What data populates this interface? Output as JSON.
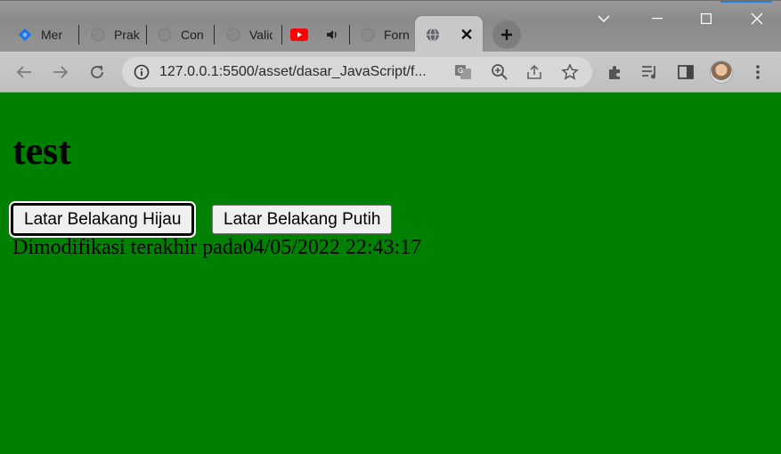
{
  "browser": {
    "tabs": [
      {
        "label": "Mer",
        "icon": "blue-diamond-icon"
      },
      {
        "label": "Prak",
        "icon": "globe-icon"
      },
      {
        "label": "Con",
        "icon": "globe-icon"
      },
      {
        "label": "Valid",
        "icon": "globe-icon"
      },
      {
        "label": "",
        "icon": "youtube-icon"
      },
      {
        "label": "Forn",
        "icon": "globe-icon"
      }
    ],
    "active_tab": {
      "icon": "globe-icon",
      "close": "✕"
    },
    "new_tab": "+",
    "url": "127.0.0.1:5500/asset/dasar_JavaScript/f..."
  },
  "page": {
    "heading": "test",
    "buttons": {
      "green": "Latar Belakang Hijau",
      "white": "Latar Belakang Putih"
    },
    "modified_label": "Dimodifikasi terakhir pada",
    "modified_value": "04/05/2022 22:43:17"
  },
  "colors": {
    "page_background": "#008000"
  }
}
